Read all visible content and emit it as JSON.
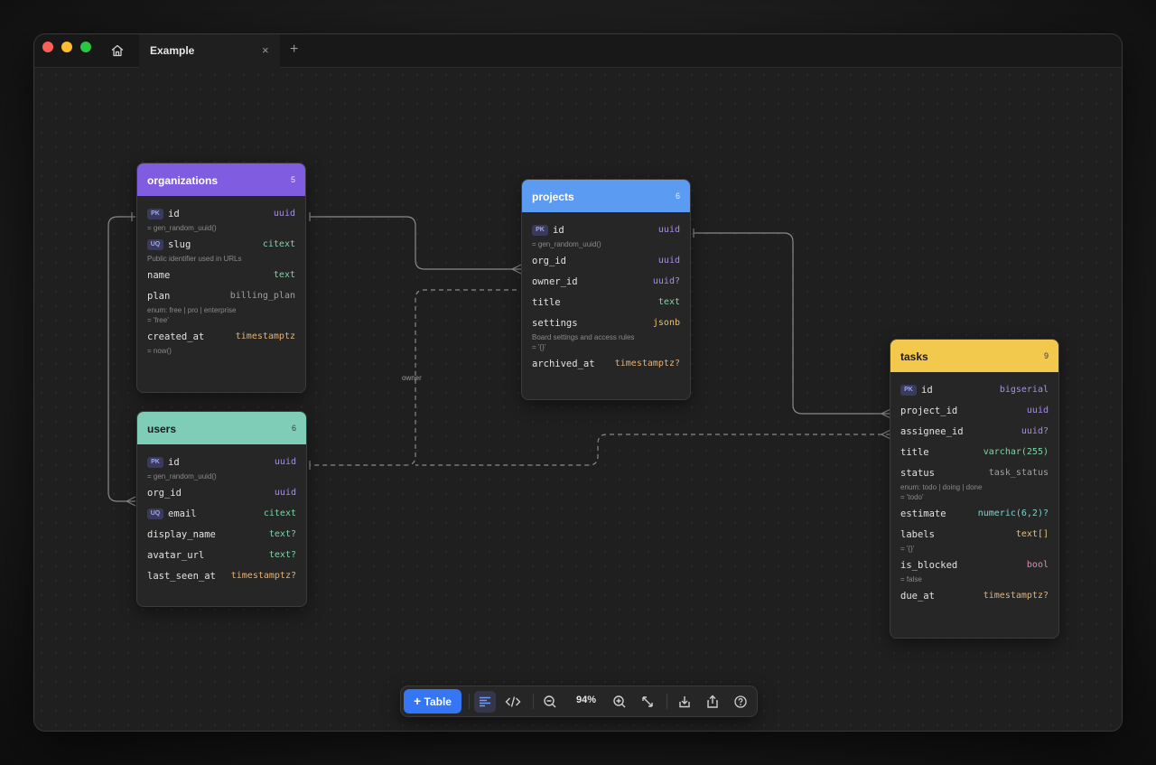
{
  "tab": {
    "title": "Example",
    "close": "×",
    "add": "+"
  },
  "canvas": {
    "edge_label": "owner"
  },
  "toolbar": {
    "add_table_label": "Table",
    "add_table_plus": "+",
    "zoom": "94%"
  },
  "tables": {
    "organizations": {
      "name": "organizations",
      "count": "5",
      "color": "#7f5ce0",
      "rows": [
        {
          "badge": "PK",
          "name": "id",
          "type": "uuid",
          "note": "= gen_random_uuid()"
        },
        {
          "badge": "UQ",
          "name": "slug",
          "type": "citext",
          "note": "Public identifier used in URLs"
        },
        {
          "name": "name",
          "type": "text"
        },
        {
          "name": "plan",
          "type": "billing_plan",
          "note": "enum: free | pro | enterprise",
          "note2": "= 'free'"
        },
        {
          "name": "created_at",
          "type": "timestamptz",
          "note": "= now()"
        }
      ]
    },
    "projects": {
      "name": "projects",
      "count": "6",
      "color": "#5b9cf2",
      "rows": [
        {
          "badge": "PK",
          "name": "id",
          "type": "uuid",
          "note": "= gen_random_uuid()"
        },
        {
          "name": "org_id",
          "type": "uuid"
        },
        {
          "name": "owner_id",
          "type": "uuid?"
        },
        {
          "name": "title",
          "type": "text"
        },
        {
          "name": "settings",
          "type": "jsonb",
          "note": "Board settings and access rules",
          "note2": "= '{}'"
        },
        {
          "name": "archived_at",
          "type": "timestamptz?"
        }
      ]
    },
    "users": {
      "name": "users",
      "count": "6",
      "color": "#7fcdb6",
      "rows": [
        {
          "badge": "PK",
          "name": "id",
          "type": "uuid",
          "note": "= gen_random_uuid()"
        },
        {
          "name": "org_id",
          "type": "uuid"
        },
        {
          "badge": "UQ",
          "name": "email",
          "type": "citext"
        },
        {
          "name": "display_name",
          "type": "text?"
        },
        {
          "name": "avatar_url",
          "type": "text?"
        },
        {
          "name": "last_seen_at",
          "type": "timestamptz?"
        }
      ]
    },
    "tasks": {
      "name": "tasks",
      "count": "9",
      "color": "#f2c94c",
      "rows": [
        {
          "badge": "PK",
          "name": "id",
          "type": "bigserial"
        },
        {
          "name": "project_id",
          "type": "uuid"
        },
        {
          "name": "assignee_id",
          "type": "uuid?"
        },
        {
          "name": "title",
          "type": "varchar(255)"
        },
        {
          "name": "status",
          "type": "task_status",
          "note": "enum: todo | doing | done",
          "note2": "= 'todo'"
        },
        {
          "name": "estimate",
          "type": "numeric(6,2)?"
        },
        {
          "name": "labels",
          "type": "text[]",
          "note": "= '{}'"
        },
        {
          "name": "is_blocked",
          "type": "bool",
          "note": "= false"
        },
        {
          "name": "due_at",
          "type": "timestamptz?"
        }
      ]
    }
  },
  "type_colors": {
    "uuid": "#a88cf0",
    "uuid?": "#a88cf0",
    "bigserial": "#a88cf0",
    "text": "#7ed4a8",
    "text?": "#7ed4a8",
    "citext": "#7ed4a8",
    "varchar(255)": "#7ed4a8",
    "text[]": "#e8c06a",
    "timestamptz": "#e8b070",
    "timestamptz?": "#e8b070",
    "jsonb": "#e8c06a",
    "bool": "#e08ab8",
    "numeric(6,2)?": "#7ed4cc",
    "billing_plan": "#a0a0a0",
    "task_status": "#a0a0a0"
  }
}
